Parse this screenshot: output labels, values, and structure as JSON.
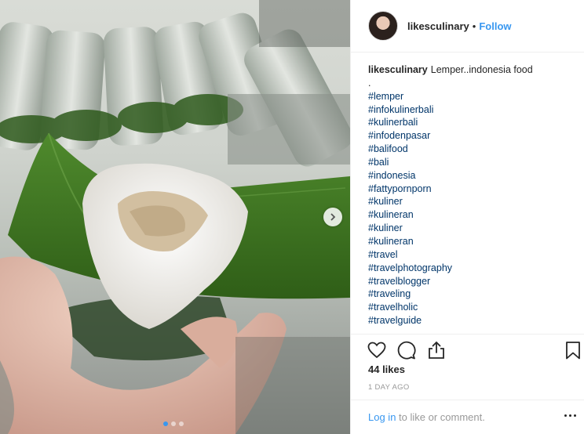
{
  "post": {
    "username": "likesculinary",
    "separator": "•",
    "follow_label": "Follow",
    "caption_text": "Lemper..indonesia food",
    "caption_dot": ".",
    "hashtags": [
      "#lemper",
      "#infokulinerbali",
      "#kulinerbali",
      "#infodenpasar",
      "#balifood",
      "#bali",
      "#indonesia",
      "#fattypornporn",
      "#kuliner",
      "#kulineran",
      "#kuliner",
      "#kulineran",
      "#travel",
      "#travelphotography",
      "#travelblogger",
      "#traveling",
      "#travelholic",
      "#travelguide"
    ],
    "likes": "44 likes",
    "timestamp": "1 DAY AGO"
  },
  "footer": {
    "login_label": "Log in",
    "rest_label": " to like or comment."
  },
  "icons": {
    "like": "heart-icon",
    "comment": "comment-icon",
    "share": "share-icon",
    "save": "bookmark-icon",
    "next": "chevron-right-icon",
    "more": "more-options-icon"
  },
  "colors": {
    "accent": "#3897f0",
    "hashtag": "#003569",
    "muted": "#999999"
  },
  "carousel": {
    "slides": 3,
    "active": 1
  }
}
